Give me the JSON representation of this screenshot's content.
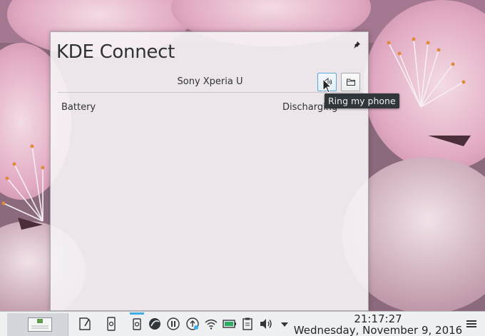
{
  "popup": {
    "title": "KDE Connect",
    "device_name": "Sony Xperia U",
    "battery_label": "Battery",
    "battery_status": "Discharging",
    "tooltip": "Ring my phone"
  },
  "clock": {
    "time": "21:17:27",
    "date": "Wednesday, November 9, 2016"
  },
  "colors": {
    "accent": "#3daee9",
    "panel": "#eff0f1",
    "tooltip_bg": "#31363b",
    "text": "#2f3234"
  },
  "icons": {
    "pin": "pin-icon",
    "ring": "speaker-icon",
    "browse": "folder-icon",
    "tray": [
      "notes-icon",
      "kdeconnect-icon",
      "kdeconnect-active-icon",
      "ktorrent-icon",
      "media-pause-icon",
      "updates-icon",
      "wifi-icon",
      "battery-icon",
      "clipboard-icon",
      "volume-icon",
      "expand-tray-icon"
    ],
    "menu": "hamburger-icon"
  }
}
